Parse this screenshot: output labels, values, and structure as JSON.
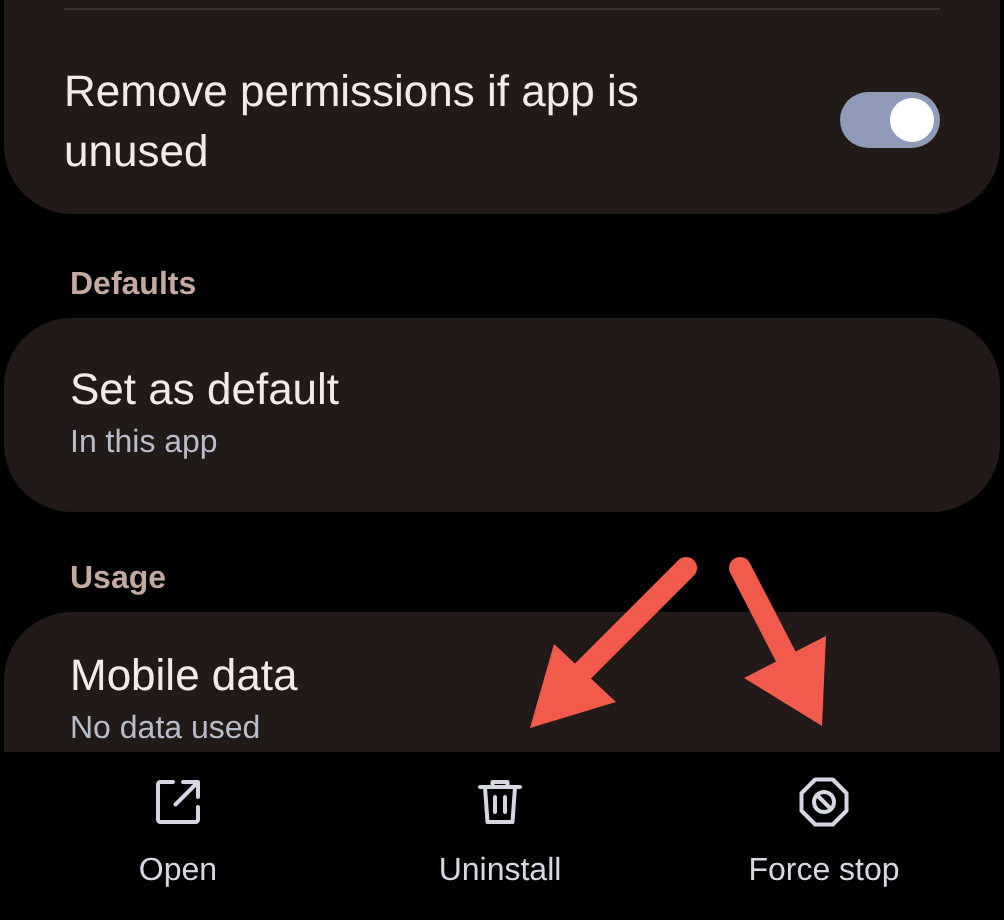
{
  "permissions_card": {
    "title": "Remove permissions if app is unused",
    "toggle": {
      "on": true
    }
  },
  "sections": [
    {
      "header": "Defaults",
      "title": "Set as default",
      "subtitle": "In this app"
    },
    {
      "header": "Usage",
      "title": "Mobile data",
      "subtitle": "No data used"
    }
  ],
  "actions": [
    {
      "kind": "open",
      "label": "Open"
    },
    {
      "kind": "uninstall",
      "label": "Uninstall"
    },
    {
      "kind": "force_stop",
      "label": "Force stop"
    }
  ]
}
